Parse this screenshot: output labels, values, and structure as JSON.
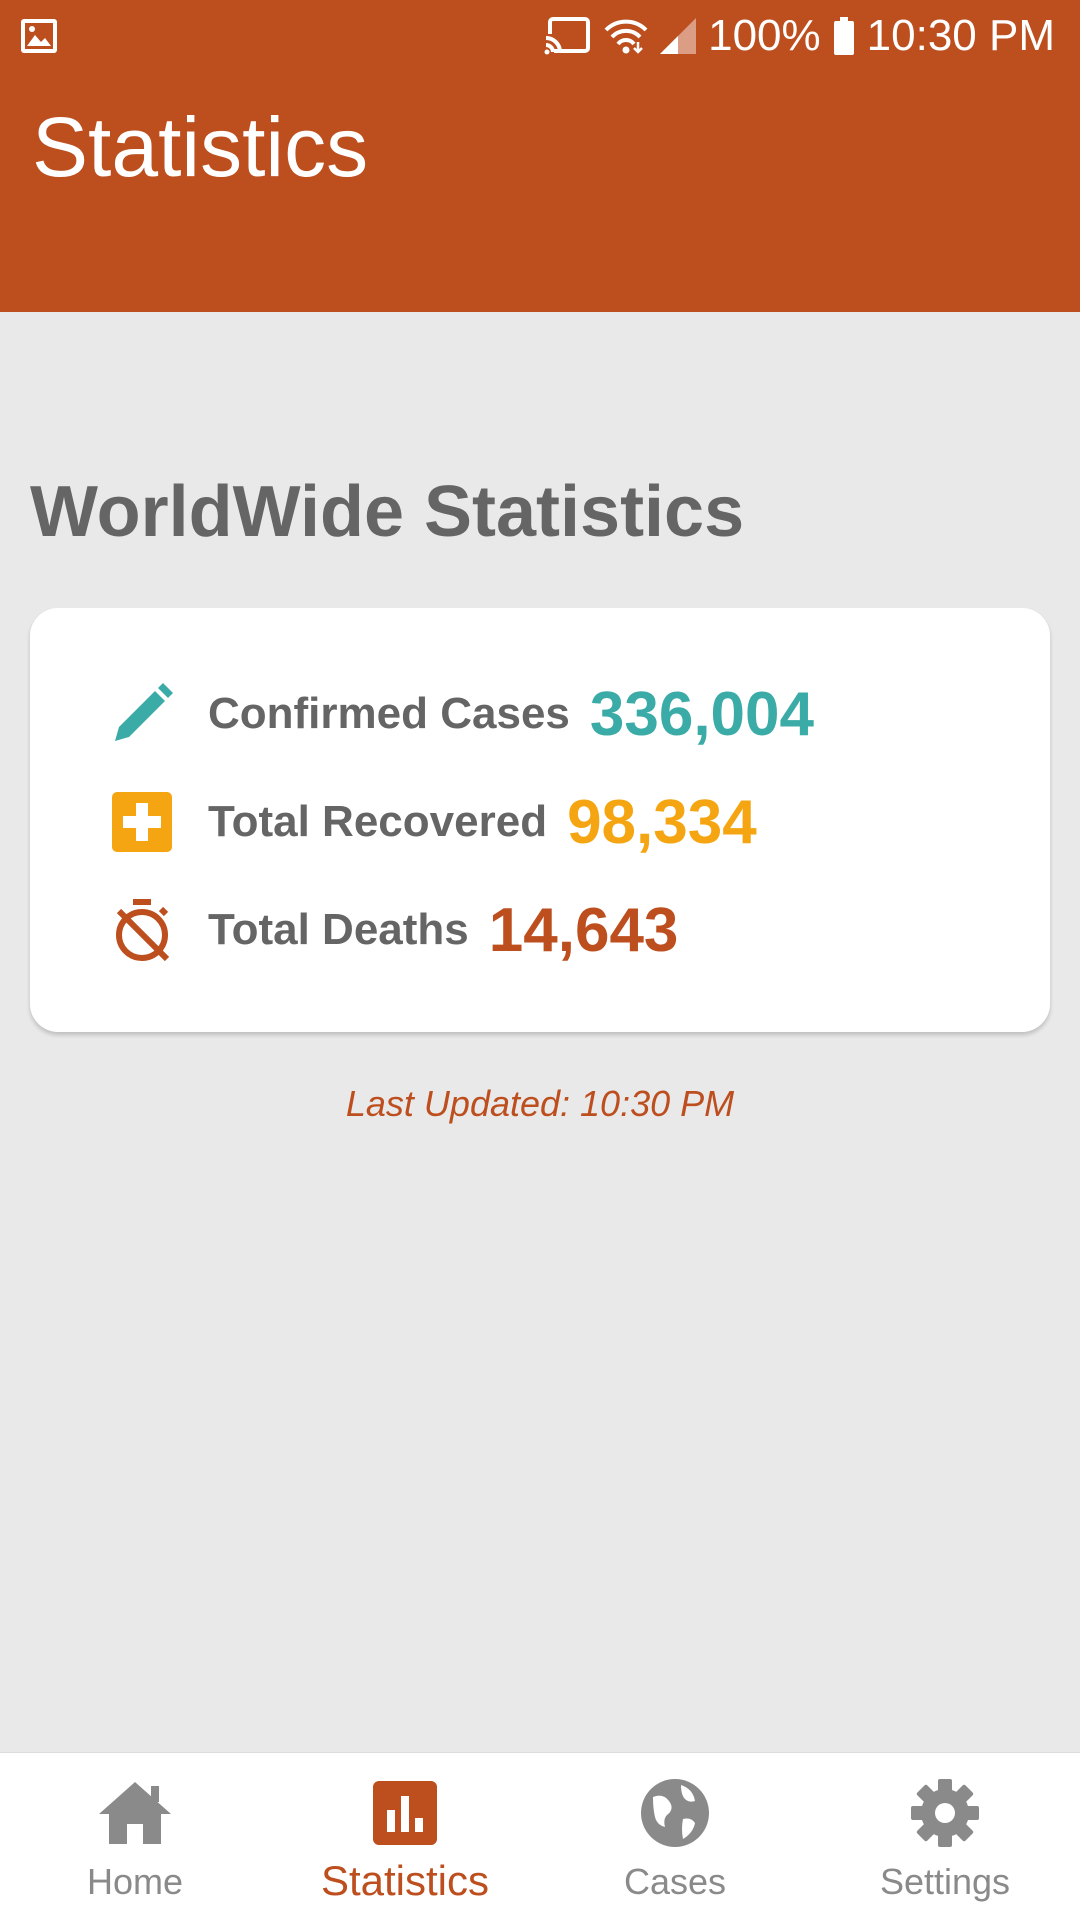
{
  "status_bar": {
    "left_icon": "image-notification-icon",
    "battery": "100%",
    "time": "10:30 PM"
  },
  "app_bar": {
    "title": "Statistics"
  },
  "main": {
    "section_title": "WorldWide Statistics",
    "stats": [
      {
        "icon": "pencil-icon",
        "label": "Confirmed Cases",
        "value": "336,004",
        "color": "#3aaba7"
      },
      {
        "icon": "plus-box-icon",
        "label": "Total Recovered",
        "value": "98,334",
        "color": "#f5a511"
      },
      {
        "icon": "timer-off-icon",
        "label": "Total Deaths",
        "value": "14,643",
        "color": "#bd4e1e"
      }
    ],
    "last_updated": "Last Updated: 10:30 PM"
  },
  "bottom_nav": {
    "items": [
      {
        "label": "Home",
        "icon": "home-icon",
        "active": false
      },
      {
        "label": "Statistics",
        "icon": "bar-chart-icon",
        "active": true
      },
      {
        "label": "Cases",
        "icon": "globe-icon",
        "active": false
      },
      {
        "label": "Settings",
        "icon": "gear-icon",
        "active": false
      }
    ]
  },
  "colors": {
    "brand": "#bd4e1e",
    "background": "#e9e9ea",
    "text_gray": "#656565"
  }
}
